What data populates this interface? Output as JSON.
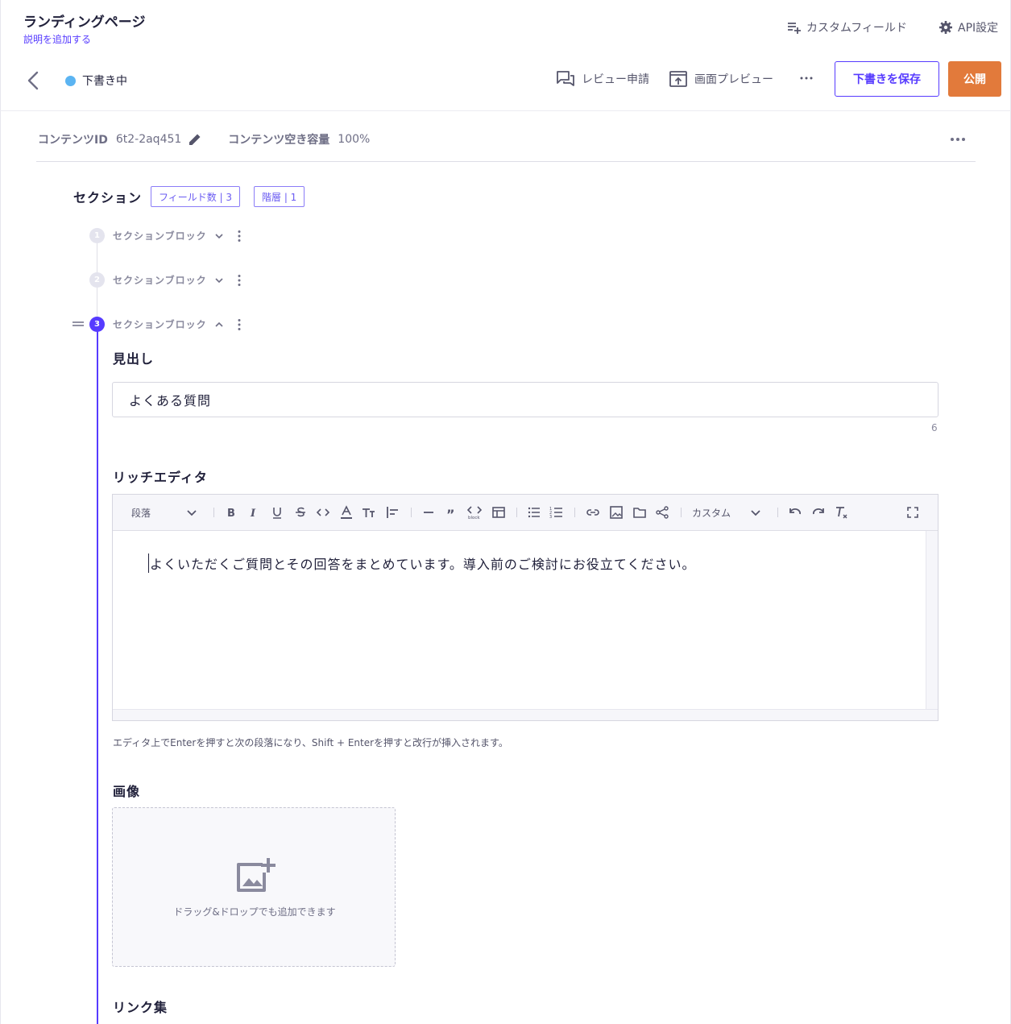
{
  "header": {
    "title": "ランディングページ",
    "description": "説明を追加する",
    "custom_field": "カスタムフィールド",
    "api_settings": "API設定"
  },
  "toolbar": {
    "status": "下書き中",
    "status_color": "#5bb4f2",
    "review_request": "レビュー申請",
    "preview": "画面プレビュー",
    "save_draft": "下書きを保存",
    "publish": "公開",
    "accent_color": "#563bff",
    "publish_color": "#e27a3b"
  },
  "meta": {
    "content_id_label": "コンテンツID",
    "content_id_value": "6t2-2aq451",
    "capacity_label": "コンテンツ空き容量",
    "capacity_value": "100%"
  },
  "section": {
    "title": "セクション",
    "field_count_tag": "フィールド数 | 3",
    "depth_tag": "階層 | 1",
    "blocks": [
      {
        "num": "1",
        "label": "セクションブロック",
        "expanded": false
      },
      {
        "num": "2",
        "label": "セクションブロック",
        "expanded": false
      },
      {
        "num": "3",
        "label": "セクションブロック",
        "expanded": true
      }
    ]
  },
  "fields": {
    "heading_label": "見出し",
    "heading_value": "よくある質問",
    "heading_count": "6",
    "rich_label": "リッチエディタ",
    "rich_paragraph_select": "段落",
    "rich_custom_select": "カスタム",
    "rich_value": "よくいただくご質問とその回答をまとめています。導入前のご検討にお役立てください。",
    "rich_hint": "エディタ上でEnterを押すと次の段落になり、Shift + Enterを押すと改行が挿入されます。",
    "image_label": "画像",
    "image_drop_text": "ドラッグ&ドロップでも追加できます",
    "links_label": "リンク集"
  }
}
